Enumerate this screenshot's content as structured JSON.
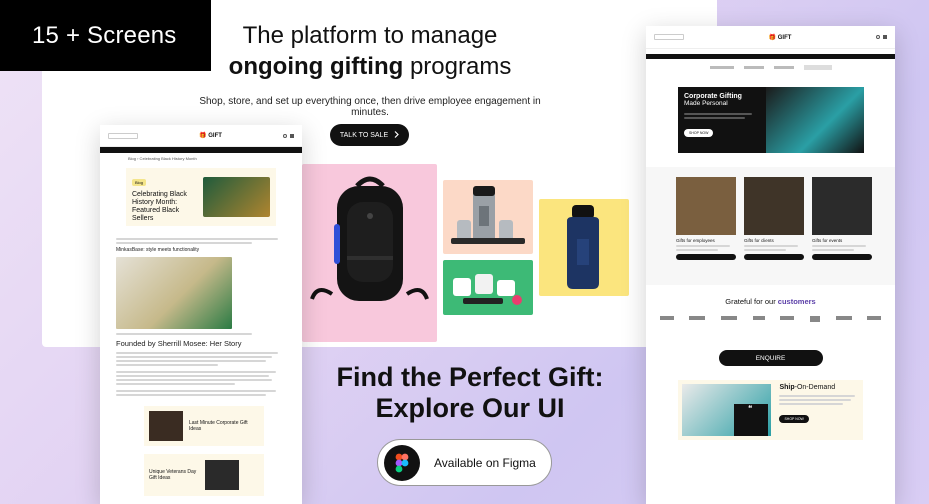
{
  "badge": "15 + Screens",
  "hero": {
    "headline_line1": "The platform to manage",
    "headline_bold": "ongoing gifting",
    "headline_rest": "programs",
    "subline": "Shop, store, and set up everything once, then drive employee engagement in minutes.",
    "cta_label": "TALK TO SALE"
  },
  "cta_section": {
    "title_line1": "Find the Perfect Gift:",
    "title_line2": "Explore Our UI",
    "figma_label": "Available on Figma"
  },
  "left_mock": {
    "logo": "GIFT",
    "breadcrumb": "Blog › Celebrating Black History Month",
    "feature_title": "Celebrating Black History Month: Featured Black Sellers",
    "feature_tag": "Blog",
    "section_title": "Founded by Sherrill Mosee: Her Story",
    "subhead": "MinkasBase: style meets functionality",
    "card1_title": "Last Minute Corporate Gift Ideas",
    "card2_title": "Unique Veterans Day Gift Ideas"
  },
  "right_mock": {
    "logo": "GIFT",
    "hero_title": "Corporate Gifting",
    "hero_sub": "Made Personal",
    "hero_btn": "SHOP NOW",
    "cat1": "Gifts for employees",
    "cat2": "Gifts for clients",
    "cat3": "Gifts for events",
    "grateful": "Grateful for our",
    "grateful_bold": "customers",
    "enquire": "ENQUIRE",
    "ship_bold": "Ship",
    "ship_rest": "-On-Demand",
    "ship_btn": "SHOP NOW"
  },
  "colors": {
    "accent_dark": "#111111",
    "pink_tile": "#f8c8dc",
    "peach_tile": "#fcd9c7",
    "green_tile": "#3dba76",
    "yellow_tile": "#fbe57e",
    "teal_product": "#2a9fa5",
    "navy_bottle": "#1d3463"
  }
}
